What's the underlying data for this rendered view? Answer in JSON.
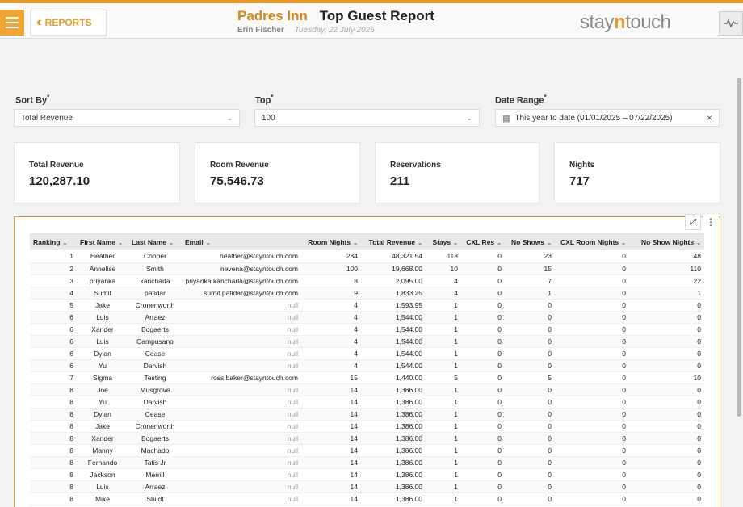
{
  "header": {
    "reports_label": "REPORTS",
    "hotel": "Padres Inn",
    "report_title": "Top Guest Report",
    "user": "Erin Fischer",
    "date": "Tuesday, 22 July 2025",
    "brand_pre": "stay",
    "brand_n": "n",
    "brand_post": "touch"
  },
  "filters": {
    "sort_by": {
      "label": "Sort By",
      "required": "*",
      "value": "Total Revenue"
    },
    "top": {
      "label": "Top",
      "required": "*",
      "value": "100"
    },
    "date_range": {
      "label": "Date Range",
      "required": "*",
      "value": "This year to date (01/01/2025 – 07/22/2025)"
    }
  },
  "kpis": [
    {
      "label": "Total Revenue",
      "value": "120,287.10"
    },
    {
      "label": "Room Revenue",
      "value": "75,546.73"
    },
    {
      "label": "Reservations",
      "value": "211"
    },
    {
      "label": "Nights",
      "value": "717"
    }
  ],
  "table": {
    "columns": [
      "Ranking",
      "First Name",
      "Last Name",
      "Email",
      "Room Nights",
      "Total Revenue",
      "Stays",
      "CXL Res",
      "No Shows",
      "CXL Room Nights",
      "No Show Nights"
    ],
    "rows": [
      [
        "1",
        "Heather",
        "Cooper",
        "heather@stayntouch.com",
        "284",
        "48,321.54",
        "118",
        "0",
        "23",
        "0",
        "48"
      ],
      [
        "2",
        "Annelise",
        "Smith",
        "nevena@stayntouch.com",
        "100",
        "19,668.00",
        "10",
        "0",
        "15",
        "0",
        "110"
      ],
      [
        "3",
        "priyanka",
        "kancharla",
        "priyanka.kancharla@stayntouch.com",
        "8",
        "2,095.00",
        "4",
        "0",
        "7",
        "0",
        "22"
      ],
      [
        "4",
        "Sumit",
        "patidar",
        "sumit.patidar@stayntouch.com",
        "9",
        "1,833.25",
        "4",
        "0",
        "1",
        "0",
        "1"
      ],
      [
        "5",
        "Jake",
        "Cronenworth",
        "null",
        "4",
        "1,593.95",
        "1",
        "0",
        "0",
        "0",
        "0"
      ],
      [
        "6",
        "Luis",
        "Arraez",
        "null",
        "4",
        "1,544.00",
        "1",
        "0",
        "0",
        "0",
        "0"
      ],
      [
        "6",
        "Xander",
        "Bogaerts",
        "null",
        "4",
        "1,544.00",
        "1",
        "0",
        "0",
        "0",
        "0"
      ],
      [
        "6",
        "Luis",
        "Campusano",
        "null",
        "4",
        "1,544.00",
        "1",
        "0",
        "0",
        "0",
        "0"
      ],
      [
        "6",
        "Dylan",
        "Cease",
        "null",
        "4",
        "1,544.00",
        "1",
        "0",
        "0",
        "0",
        "0"
      ],
      [
        "6",
        "Yu",
        "Darvish",
        "null",
        "4",
        "1,544.00",
        "1",
        "0",
        "0",
        "0",
        "0"
      ],
      [
        "7",
        "Sigma",
        "Testing",
        "ross.baker@stayntouch.com",
        "15",
        "1,440.00",
        "5",
        "0",
        "5",
        "0",
        "10"
      ],
      [
        "8",
        "Joe",
        "Musgrove",
        "null",
        "14",
        "1,386.00",
        "1",
        "0",
        "0",
        "0",
        "0"
      ],
      [
        "8",
        "Yu",
        "Darvish",
        "null",
        "14",
        "1,386.00",
        "1",
        "0",
        "0",
        "0",
        "0"
      ],
      [
        "8",
        "Dylan",
        "Cease",
        "null",
        "14",
        "1,386.00",
        "1",
        "0",
        "0",
        "0",
        "0"
      ],
      [
        "8",
        "Jake",
        "Cronenworth",
        "null",
        "14",
        "1,386.00",
        "1",
        "0",
        "0",
        "0",
        "0"
      ],
      [
        "8",
        "Xander",
        "Bogaerts",
        "null",
        "14",
        "1,386.00",
        "1",
        "0",
        "0",
        "0",
        "0"
      ],
      [
        "8",
        "Manny",
        "Machado",
        "null",
        "14",
        "1,386.00",
        "1",
        "0",
        "0",
        "0",
        "0"
      ],
      [
        "8",
        "Fernando",
        "Tatis Jr",
        "null",
        "14",
        "1,386.00",
        "1",
        "0",
        "0",
        "0",
        "0"
      ],
      [
        "8",
        "Jackson",
        "Merrill",
        "null",
        "14",
        "1,386.00",
        "1",
        "0",
        "0",
        "0",
        "0"
      ],
      [
        "8",
        "Luis",
        "Arraez",
        "null",
        "14",
        "1,386.00",
        "1",
        "0",
        "0",
        "0",
        "0"
      ],
      [
        "8",
        "Mike",
        "Shildt",
        "null",
        "14",
        "1,386.00",
        "1",
        "0",
        "0",
        "0",
        "0"
      ]
    ]
  },
  "colors": {
    "accent": "#e59b2b",
    "hotel": "#d4871c"
  },
  "icons": {
    "menu": "hamburger-icon",
    "back": "double-chevron-left-icon",
    "pulse": "pulse-icon",
    "calendar": "calendar-icon",
    "expand": "expand-icon",
    "more": "more-vertical-icon"
  }
}
